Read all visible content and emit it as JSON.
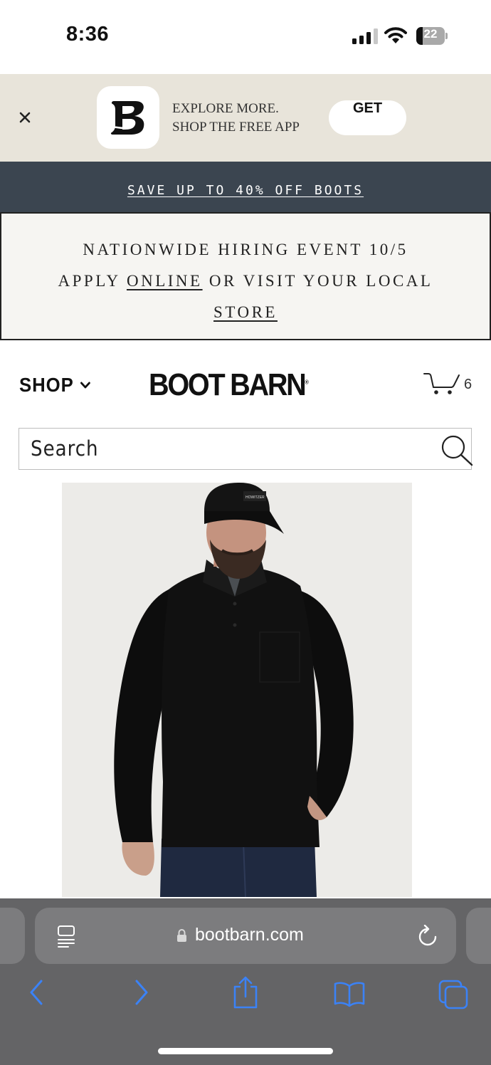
{
  "status_bar": {
    "time": "8:36",
    "battery": "22",
    "battery_level_percent": 22
  },
  "app_banner": {
    "close_icon": "close-icon",
    "line1": "EXPLORE MORE.",
    "line2": "SHOP THE FREE APP",
    "get_label": "GET"
  },
  "promo": {
    "text": "SAVE UP TO 40% OFF BOOTS"
  },
  "hiring": {
    "line1": "NATIONWIDE HIRING EVENT 10/5",
    "line2_prefix": "APPLY",
    "online_link": "ONLINE",
    "line2_suffix": "OR VISIT YOUR LOCAL",
    "store_link": "STORE"
  },
  "header": {
    "shop_label": "SHOP",
    "logo": "BOOT BARN",
    "logo_mark": "®",
    "cart_count": "6"
  },
  "search": {
    "placeholder": "Search",
    "icon": "search-icon"
  },
  "product": {
    "image": "man-in-black-pullover-and-cap"
  },
  "browser": {
    "url": "bootbarn.com",
    "icons": [
      "reader-icon",
      "lock-icon",
      "reload-icon",
      "back-icon",
      "forward-icon",
      "share-icon",
      "bookmarks-icon",
      "tabs-icon"
    ]
  },
  "colors": {
    "banner_bg": "#e8e4da",
    "promo_bg": "#3b4550",
    "hiring_bg": "#f6f5f2",
    "safari_bar": "#646466",
    "safari_icon_blue": "#3b82f6"
  }
}
